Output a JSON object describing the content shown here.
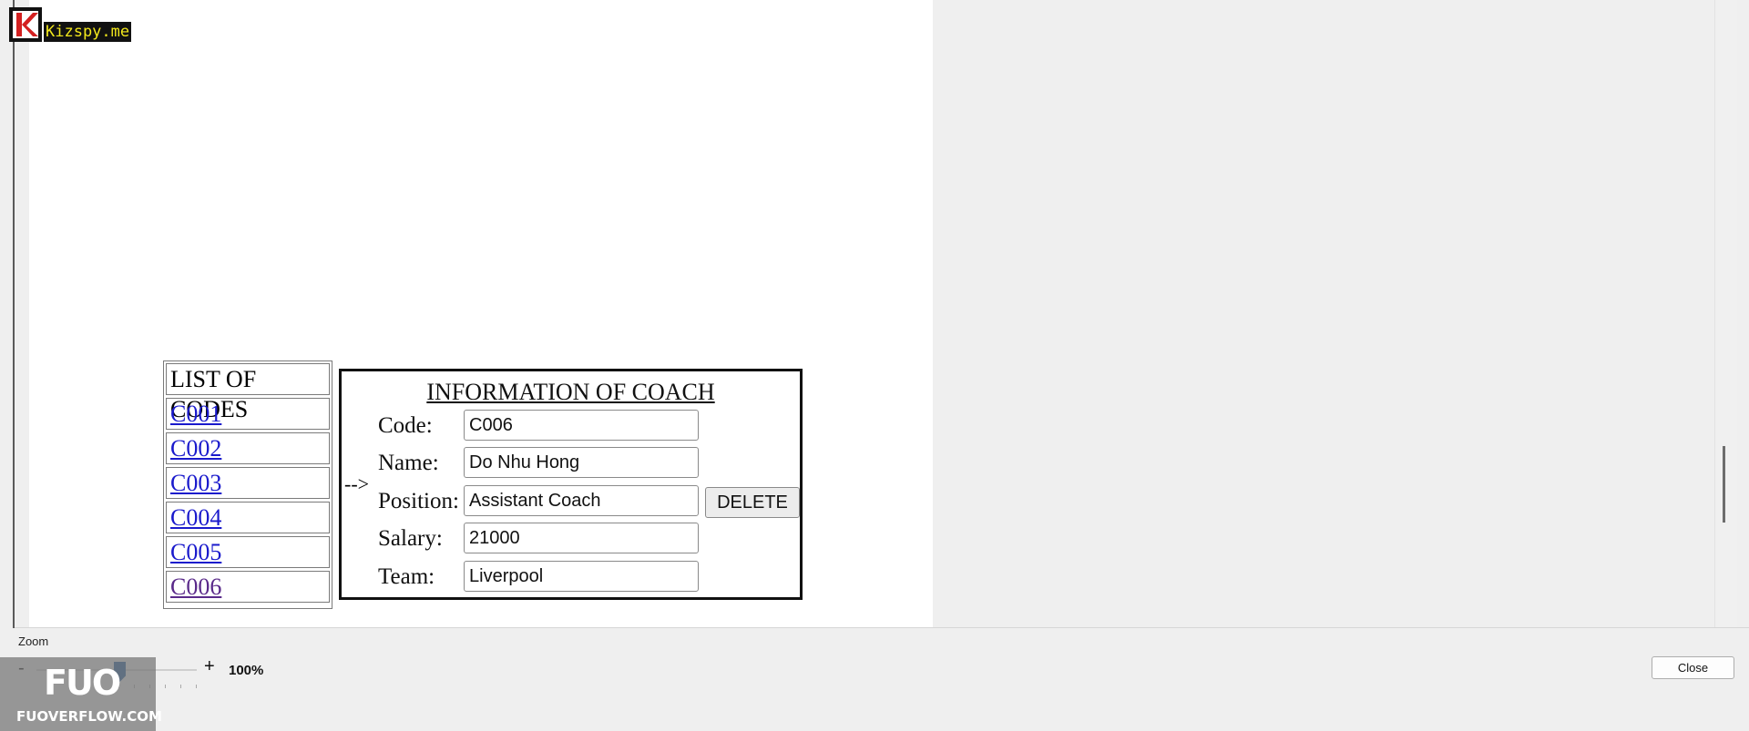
{
  "watermarks": {
    "top_logo_text": "Kizspy.me",
    "bottom_logo_mark": "FUO",
    "bottom_logo_text": "FUOVERFLOW.COM"
  },
  "codes_table": {
    "header": "LIST OF CODES",
    "codes": [
      "C001",
      "C002",
      "C003",
      "C004",
      "C005",
      "C006"
    ]
  },
  "arrow_text": "-->",
  "coach_info": {
    "title": "INFORMATION OF COACH",
    "fields": [
      {
        "label": "Code:",
        "value": "C006"
      },
      {
        "label": "Name:",
        "value": "Do Nhu Hong"
      },
      {
        "label": "Position:",
        "value": "Assistant Coach"
      },
      {
        "label": "Salary:",
        "value": "21000"
      },
      {
        "label": "Team:",
        "value": "Liverpool"
      }
    ],
    "delete_label": "DELETE"
  },
  "zoom": {
    "label": "Zoom",
    "minus": "-",
    "plus": "+",
    "value": "100%",
    "level_fraction": 0.49
  },
  "footer": {
    "close_label": "Close"
  },
  "colors": {
    "link": "#1a1acc",
    "visited_link": "#5a2a8a",
    "slider_thumb": "#1d5a9c"
  }
}
